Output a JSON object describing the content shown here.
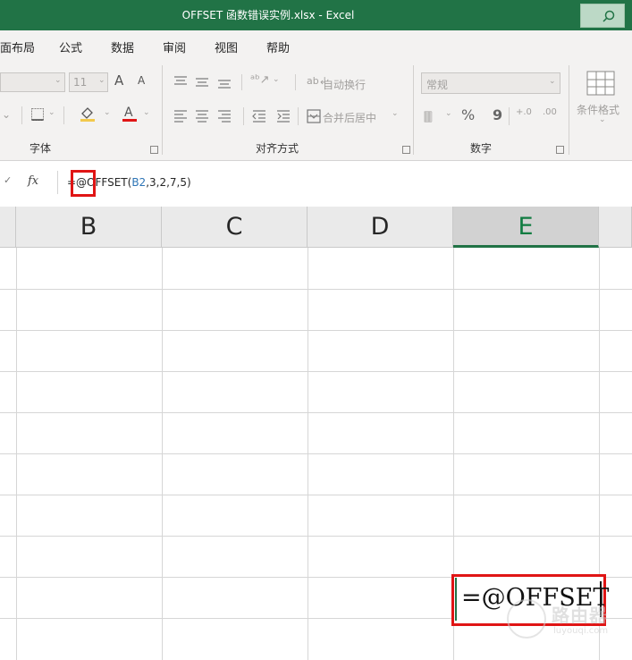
{
  "window": {
    "title": "OFFSET 函数错误实例.xlsx  -  Excel"
  },
  "ribbon_tabs": [
    "面布局",
    "公式",
    "数据",
    "审阅",
    "视图",
    "帮助"
  ],
  "font_group": {
    "size": "11",
    "grow": "A",
    "shrink": "A",
    "label": "字体"
  },
  "align_group": {
    "wrap": "自动换行",
    "merge": "合并后居中",
    "label": "对齐方式"
  },
  "number_group": {
    "format": "常规",
    "percent": "%",
    "comma": "9",
    "inc_dec": "+.0",
    "dec_dec": ".00",
    "label": "数字"
  },
  "styles_group": {
    "conditional": "条件格式"
  },
  "formula_bar": {
    "fx": "fx",
    "prefix": "=@O",
    "mid": "FFSET(",
    "ref": "B2",
    "suffix": ",3,2,7,5)"
  },
  "columns": [
    "B",
    "C",
    "D",
    "E"
  ],
  "selected_column": "E",
  "active_cell": {
    "text": "=@OFFSET"
  },
  "watermark": {
    "main": "路由器",
    "sub": "luyouqi.com"
  },
  "colors": {
    "excel_green": "#217346",
    "highlight_red": "#e01515",
    "ref_blue": "#2e75b6"
  },
  "icons": [
    "search-icon",
    "fx-icon",
    "border-icon",
    "fill-color-icon",
    "font-color-icon",
    "orientation-icon",
    "wrap-text-icon",
    "merge-icon",
    "currency-icon",
    "conditional-format-icon"
  ]
}
